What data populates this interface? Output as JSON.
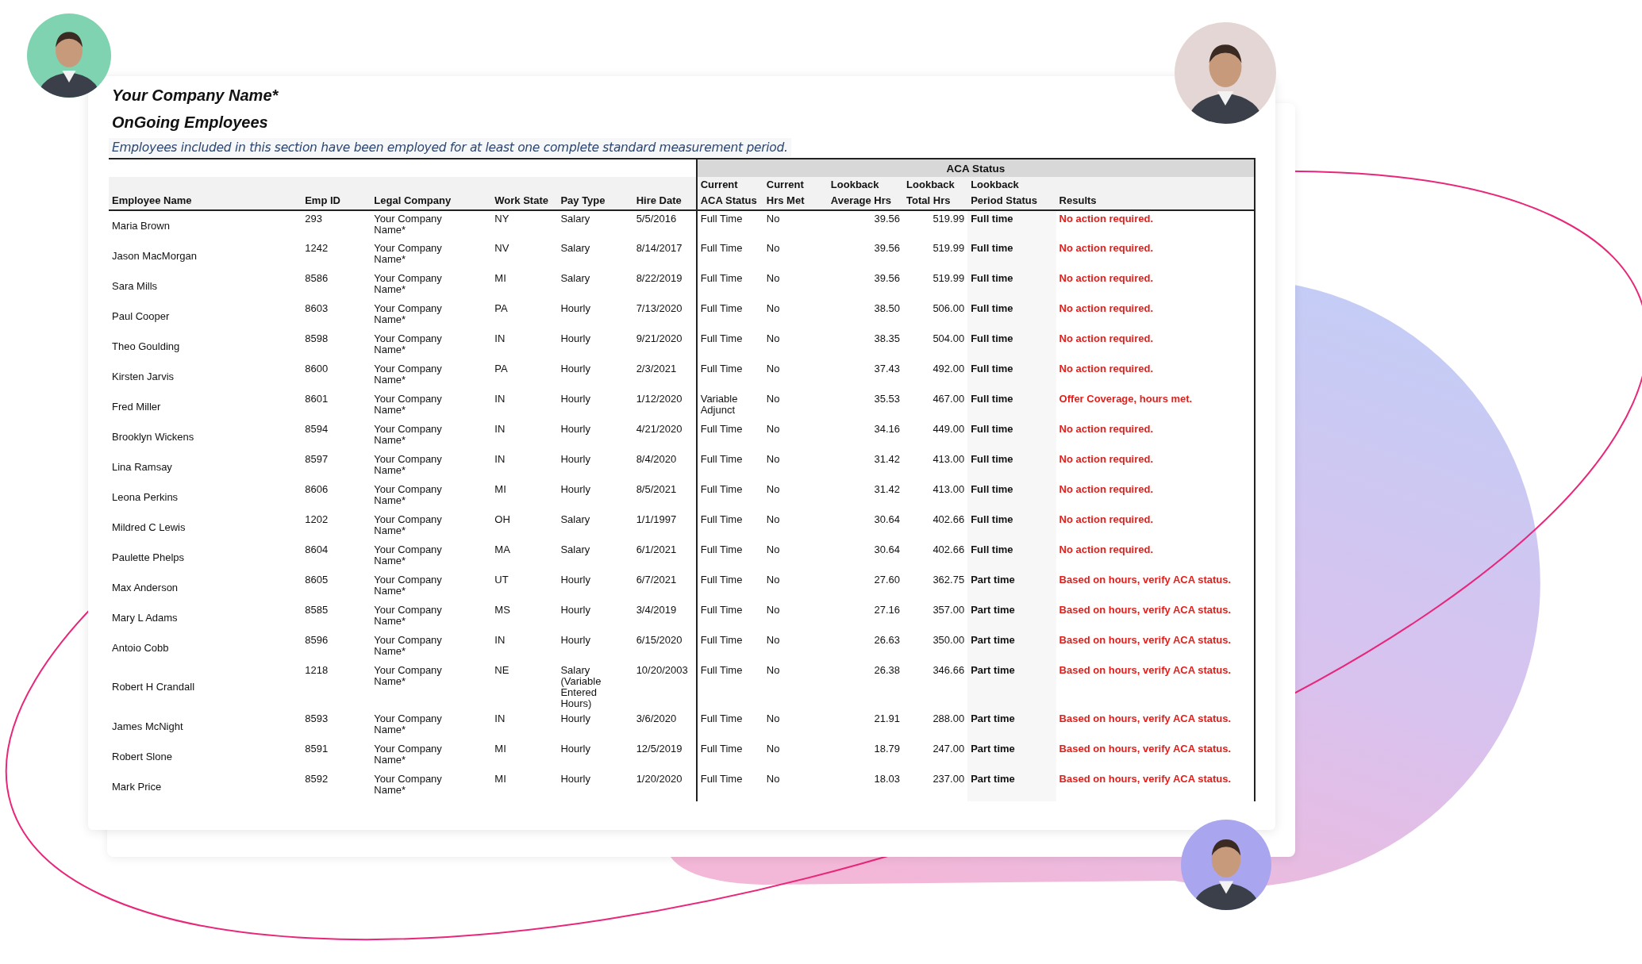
{
  "report": {
    "company": "Your Company Name*",
    "title": "OnGoing Employees",
    "note": "Employees included in this section have been employed for at least one complete standard measurement period."
  },
  "table": {
    "group_header": "ACA Status",
    "columns": [
      "Employee Name",
      "Emp ID",
      "Legal Company",
      "Work State",
      "Pay Type",
      "Hire Date",
      "Current\nACA Status",
      "Current\nHrs Met",
      "Lookback\nAverage Hrs",
      "Lookback\nTotal Hrs",
      "Lookback\nPeriod Status",
      "Results"
    ],
    "rows": [
      {
        "name": "Maria Brown",
        "emp_id": "293",
        "legal_company": "Your Company Name*",
        "work_state": "NY",
        "pay_type": "Salary",
        "hire_date": "5/5/2016",
        "aca_status": "Full Time",
        "hrs_met": "No",
        "avg_hrs": "39.56",
        "total_hrs": "519.99",
        "period_status": "Full time",
        "result": "No action required."
      },
      {
        "name": "Jason MacMorgan",
        "emp_id": "1242",
        "legal_company": "Your Company Name*",
        "work_state": "NV",
        "pay_type": "Salary",
        "hire_date": "8/14/2017",
        "aca_status": "Full Time",
        "hrs_met": "No",
        "avg_hrs": "39.56",
        "total_hrs": "519.99",
        "period_status": "Full time",
        "result": "No action required."
      },
      {
        "name": "Sara Mills",
        "emp_id": "8586",
        "legal_company": "Your Company Name*",
        "work_state": "MI",
        "pay_type": "Salary",
        "hire_date": "8/22/2019",
        "aca_status": "Full Time",
        "hrs_met": "No",
        "avg_hrs": "39.56",
        "total_hrs": "519.99",
        "period_status": "Full time",
        "result": "No action required."
      },
      {
        "name": "Paul Cooper",
        "emp_id": "8603",
        "legal_company": "Your Company Name*",
        "work_state": "PA",
        "pay_type": "Hourly",
        "hire_date": "7/13/2020",
        "aca_status": "Full Time",
        "hrs_met": "No",
        "avg_hrs": "38.50",
        "total_hrs": "506.00",
        "period_status": "Full time",
        "result": "No action required."
      },
      {
        "name": "Theo Goulding",
        "emp_id": "8598",
        "legal_company": "Your Company Name*",
        "work_state": "IN",
        "pay_type": "Hourly",
        "hire_date": "9/21/2020",
        "aca_status": "Full Time",
        "hrs_met": "No",
        "avg_hrs": "38.35",
        "total_hrs": "504.00",
        "period_status": "Full time",
        "result": "No action required."
      },
      {
        "name": "Kirsten Jarvis",
        "emp_id": "8600",
        "legal_company": "Your Company Name*",
        "work_state": "PA",
        "pay_type": "Hourly",
        "hire_date": "2/3/2021",
        "aca_status": "Full Time",
        "hrs_met": "No",
        "avg_hrs": "37.43",
        "total_hrs": "492.00",
        "period_status": "Full time",
        "result": "No action required."
      },
      {
        "name": "Fred Miller",
        "emp_id": "8601",
        "legal_company": "Your Company Name*",
        "work_state": "IN",
        "pay_type": "Hourly",
        "hire_date": "1/12/2020",
        "aca_status": "Variable Adjunct",
        "hrs_met": "No",
        "avg_hrs": "35.53",
        "total_hrs": "467.00",
        "period_status": "Full time",
        "result": "Offer Coverage, hours met."
      },
      {
        "name": "Brooklyn Wickens",
        "emp_id": "8594",
        "legal_company": "Your Company Name*",
        "work_state": "IN",
        "pay_type": "Hourly",
        "hire_date": "4/21/2020",
        "aca_status": "Full Time",
        "hrs_met": "No",
        "avg_hrs": "34.16",
        "total_hrs": "449.00",
        "period_status": "Full time",
        "result": "No action required."
      },
      {
        "name": "Lina Ramsay",
        "emp_id": "8597",
        "legal_company": "Your Company Name*",
        "work_state": "IN",
        "pay_type": "Hourly",
        "hire_date": "8/4/2020",
        "aca_status": "Full Time",
        "hrs_met": "No",
        "avg_hrs": "31.42",
        "total_hrs": "413.00",
        "period_status": "Full time",
        "result": "No action required."
      },
      {
        "name": "Leona Perkins",
        "emp_id": "8606",
        "legal_company": "Your Company Name*",
        "work_state": "MI",
        "pay_type": "Hourly",
        "hire_date": "8/5/2021",
        "aca_status": "Full Time",
        "hrs_met": "No",
        "avg_hrs": "31.42",
        "total_hrs": "413.00",
        "period_status": "Full time",
        "result": "No action required."
      },
      {
        "name": "Mildred C Lewis",
        "emp_id": "1202",
        "legal_company": "Your Company Name*",
        "work_state": "OH",
        "pay_type": "Salary",
        "hire_date": "1/1/1997",
        "aca_status": "Full Time",
        "hrs_met": "No",
        "avg_hrs": "30.64",
        "total_hrs": "402.66",
        "period_status": "Full time",
        "result": "No action required."
      },
      {
        "name": "Paulette Phelps",
        "emp_id": "8604",
        "legal_company": "Your Company Name*",
        "work_state": "MA",
        "pay_type": "Salary",
        "hire_date": "6/1/2021",
        "aca_status": "Full Time",
        "hrs_met": "No",
        "avg_hrs": "30.64",
        "total_hrs": "402.66",
        "period_status": "Full time",
        "result": "No action required."
      },
      {
        "name": "Max Anderson",
        "emp_id": "8605",
        "legal_company": "Your Company Name*",
        "work_state": "UT",
        "pay_type": "Hourly",
        "hire_date": "6/7/2021",
        "aca_status": "Full Time",
        "hrs_met": "No",
        "avg_hrs": "27.60",
        "total_hrs": "362.75",
        "period_status": "Part time",
        "result": "Based on hours, verify ACA status."
      },
      {
        "name": "Mary L Adams",
        "emp_id": "8585",
        "legal_company": "Your Company Name*",
        "work_state": "MS",
        "pay_type": "Hourly",
        "hire_date": "3/4/2019",
        "aca_status": "Full Time",
        "hrs_met": "No",
        "avg_hrs": "27.16",
        "total_hrs": "357.00",
        "period_status": "Part time",
        "result": "Based on hours, verify ACA status."
      },
      {
        "name": "Antoio Cobb",
        "emp_id": "8596",
        "legal_company": "Your Company Name*",
        "work_state": "IN",
        "pay_type": "Hourly",
        "hire_date": "6/15/2020",
        "aca_status": "Full Time",
        "hrs_met": "No",
        "avg_hrs": "26.63",
        "total_hrs": "350.00",
        "period_status": "Part time",
        "result": "Based on hours, verify ACA status."
      },
      {
        "name": "Robert H Crandall",
        "emp_id": "1218",
        "legal_company": "Your Company Name*",
        "work_state": "NE",
        "pay_type": "Salary (Variable Entered Hours)",
        "hire_date": "10/20/2003",
        "aca_status": "Full Time",
        "hrs_met": "No",
        "avg_hrs": "26.38",
        "total_hrs": "346.66",
        "period_status": "Part time",
        "result": "Based on hours, verify ACA status."
      },
      {
        "name": "James McNight",
        "emp_id": "8593",
        "legal_company": "Your Company Name*",
        "work_state": "IN",
        "pay_type": "Hourly",
        "hire_date": "3/6/2020",
        "aca_status": "Full Time",
        "hrs_met": "No",
        "avg_hrs": "21.91",
        "total_hrs": "288.00",
        "period_status": "Part time",
        "result": "Based on hours, verify ACA status."
      },
      {
        "name": "Robert Slone",
        "emp_id": "8591",
        "legal_company": "Your Company Name*",
        "work_state": "MI",
        "pay_type": "Hourly",
        "hire_date": "12/5/2019",
        "aca_status": "Full Time",
        "hrs_met": "No",
        "avg_hrs": "18.79",
        "total_hrs": "247.00",
        "period_status": "Part time",
        "result": "Based on hours, verify ACA status."
      },
      {
        "name": "Mark Price",
        "emp_id": "8592",
        "legal_company": "Your Company Name*",
        "work_state": "MI",
        "pay_type": "Hourly",
        "hire_date": "1/20/2020",
        "aca_status": "Full Time",
        "hrs_met": "No",
        "avg_hrs": "18.03",
        "total_hrs": "237.00",
        "period_status": "Part time",
        "result": "Based on hours, verify ACA status."
      }
    ]
  }
}
